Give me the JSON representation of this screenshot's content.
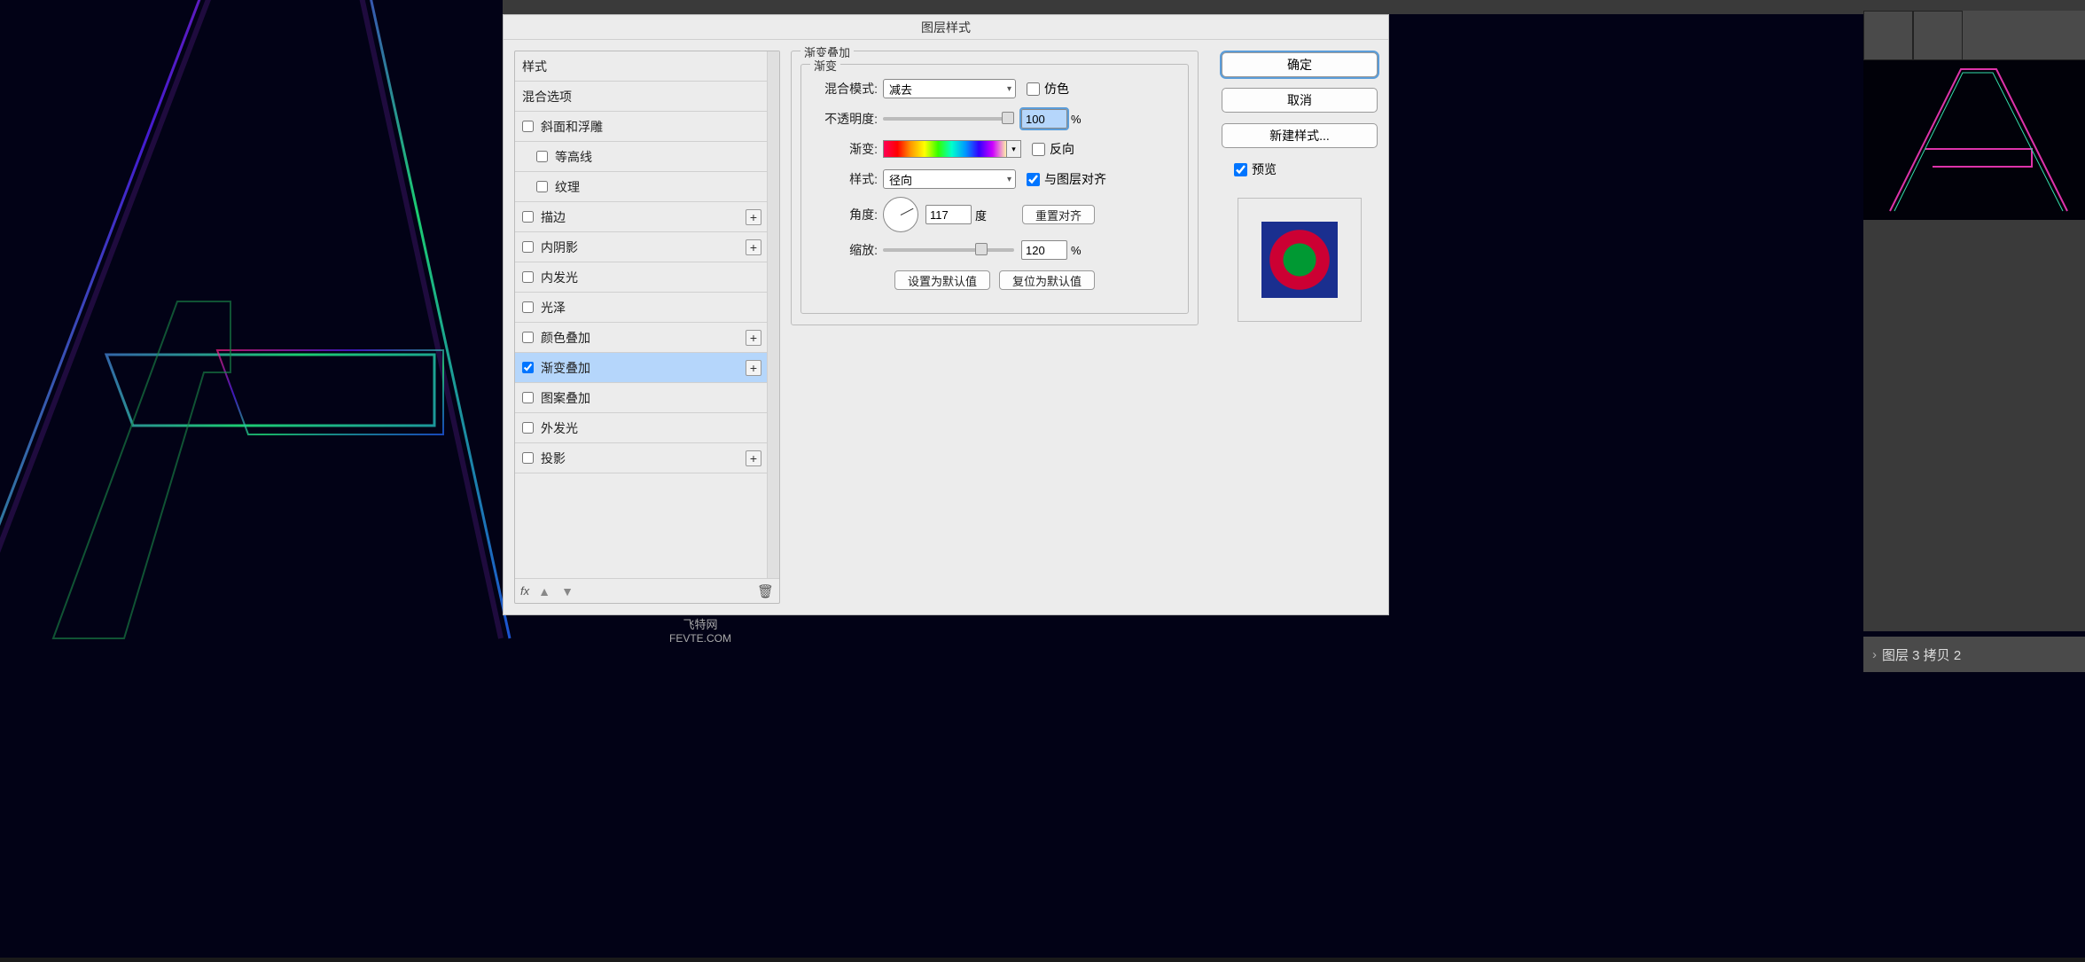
{
  "dialog": {
    "title": "图层样式",
    "styles_header": "样式",
    "blend_options": "混合选项",
    "items": [
      {
        "label": "斜面和浮雕",
        "checked": false,
        "plus": false,
        "indent": false
      },
      {
        "label": "等高线",
        "checked": false,
        "plus": false,
        "indent": true
      },
      {
        "label": "纹理",
        "checked": false,
        "plus": false,
        "indent": true
      },
      {
        "label": "描边",
        "checked": false,
        "plus": true,
        "indent": false
      },
      {
        "label": "内阴影",
        "checked": false,
        "plus": true,
        "indent": false
      },
      {
        "label": "内发光",
        "checked": false,
        "plus": false,
        "indent": false
      },
      {
        "label": "光泽",
        "checked": false,
        "plus": false,
        "indent": false
      },
      {
        "label": "颜色叠加",
        "checked": false,
        "plus": true,
        "indent": false
      },
      {
        "label": "渐变叠加",
        "checked": true,
        "plus": true,
        "indent": false,
        "selected": true
      },
      {
        "label": "图案叠加",
        "checked": false,
        "plus": false,
        "indent": false
      },
      {
        "label": "外发光",
        "checked": false,
        "plus": false,
        "indent": false
      },
      {
        "label": "投影",
        "checked": false,
        "plus": true,
        "indent": false
      }
    ],
    "fx_label": "fx"
  },
  "panel": {
    "section_title": "渐变叠加",
    "subsection_title": "渐变",
    "blend_mode_label": "混合模式:",
    "blend_mode_value": "减去",
    "dither_label": "仿色",
    "opacity_label": "不透明度:",
    "opacity_value": "100",
    "percent": "%",
    "gradient_label": "渐变:",
    "reverse_label": "反向",
    "style_label": "样式:",
    "style_value": "径向",
    "align_label": "与图层对齐",
    "angle_label": "角度:",
    "angle_value": "117",
    "degree_unit": "度",
    "reset_align": "重置对齐",
    "scale_label": "缩放:",
    "scale_value": "120",
    "make_default": "设置为默认值",
    "reset_default": "复位为默认值"
  },
  "buttons": {
    "ok": "确定",
    "cancel": "取消",
    "new_style": "新建样式...",
    "preview": "预览"
  },
  "watermark": {
    "line1": "飞特网",
    "line2": "FEVTE.COM"
  },
  "side": {
    "layer_label": "图层 3 拷贝 2"
  }
}
